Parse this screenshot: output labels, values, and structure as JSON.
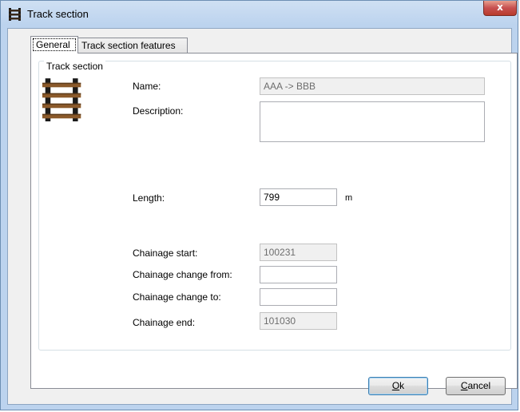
{
  "window": {
    "title": "Track section",
    "close_glyph": "x"
  },
  "tabs": [
    {
      "label": "General",
      "selected": true
    },
    {
      "label": "Track section features",
      "selected": false
    }
  ],
  "group": {
    "legend": "Track section",
    "icon": "track-rails-icon"
  },
  "fields": {
    "name": {
      "label": "Name:",
      "value": "AAA -> BBB",
      "enabled": false
    },
    "description": {
      "label": "Description:",
      "value": "",
      "enabled": true
    },
    "length": {
      "label": "Length:",
      "value": "799",
      "unit": "m",
      "enabled": true
    },
    "chainage_start": {
      "label": "Chainage start:",
      "value": "100231",
      "enabled": false
    },
    "chainage_change_from": {
      "label": "Chainage change from:",
      "value": "",
      "enabled": true
    },
    "chainage_change_to": {
      "label": "Chainage change to:",
      "value": "",
      "enabled": true
    },
    "chainage_end": {
      "label": "Chainage end:",
      "value": "101030",
      "enabled": false
    }
  },
  "buttons": {
    "ok": {
      "label_mnemonic": "O",
      "label_rest": "k"
    },
    "cancel": {
      "label_mnemonic": "C",
      "label_rest": "ancel"
    }
  },
  "colors": {
    "rail": "#1a1a1a",
    "sleeper": "#8b5a2b",
    "close_button": "#c75050"
  }
}
